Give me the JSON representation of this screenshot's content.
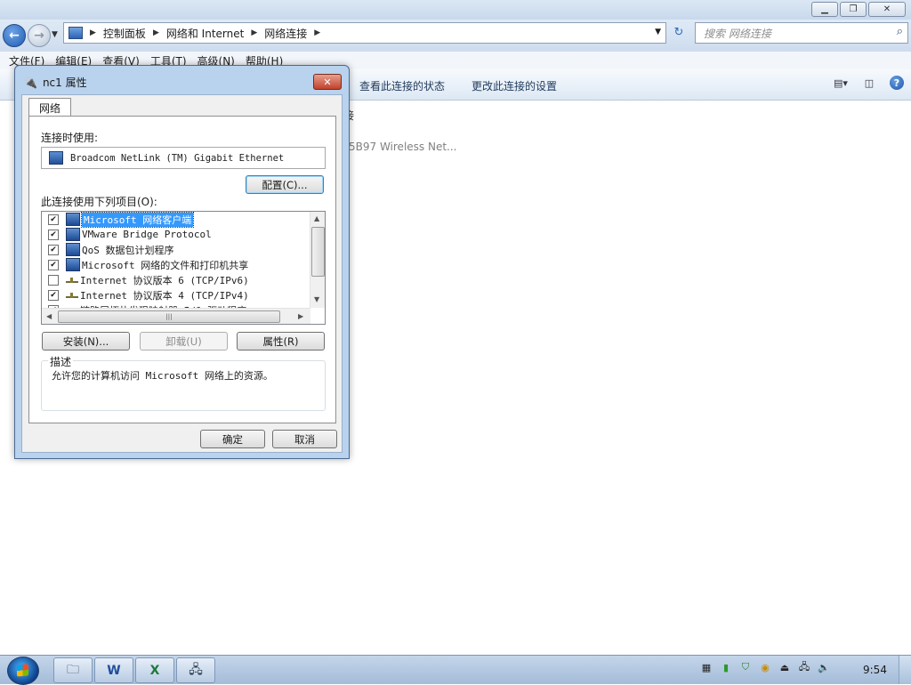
{
  "window": {
    "caption_buttons": [
      "minimize-icon",
      "restore-icon",
      "close-icon"
    ]
  },
  "navigation": {
    "breadcrumb": [
      "控制面板",
      "网络和 Internet",
      "网络连接"
    ],
    "search_placeholder": "搜索 网络连接"
  },
  "menu": [
    "文件(F)",
    "编辑(E)",
    "查看(V)",
    "工具(T)",
    "高级(N)",
    "帮助(H)"
  ],
  "command_bar": {
    "view_status": "查看此连接的状态",
    "change_settings": "更改此连接的设置"
  },
  "background": {
    "partial_label": "接",
    "partial_adapter": "5B97 Wireless Net..."
  },
  "dialog": {
    "title": "nc1 属性",
    "close_label": "✕",
    "tab": "网络",
    "connect_using_label": "连接时使用:",
    "adapter": "Broadcom NetLink (TM) Gigabit Ethernet",
    "configure_button": "配置(C)...",
    "items_label": "此连接使用下列项目(O):",
    "items": [
      {
        "label": "Microsoft 网络客户端",
        "checked": true,
        "selected": true,
        "icon": "network-client-icon"
      },
      {
        "label": "VMware Bridge Protocol",
        "checked": true,
        "selected": false,
        "icon": "network-service-icon"
      },
      {
        "label": "QoS 数据包计划程序",
        "checked": true,
        "selected": false,
        "icon": "network-service-icon"
      },
      {
        "label": "Microsoft 网络的文件和打印机共享",
        "checked": true,
        "selected": false,
        "icon": "network-service-icon"
      },
      {
        "label": "Internet 协议版本 6 (TCP/IPv6)",
        "checked": false,
        "selected": false,
        "icon": "protocol-icon"
      },
      {
        "label": "Internet 协议版本 4 (TCP/IPv4)",
        "checked": true,
        "selected": false,
        "icon": "protocol-icon"
      },
      {
        "label": "链路层拓扑发现映射器 I/O 驱动程序",
        "checked": true,
        "selected": false,
        "icon": "protocol-icon"
      }
    ],
    "install_button": "安装(N)...",
    "uninstall_button": "卸载(U)",
    "properties_button": "属性(R)",
    "description_label": "描述",
    "description_text": "允许您的计算机访问 Microsoft 网络上的资源。",
    "ok_button": "确定",
    "cancel_button": "取消"
  },
  "taskbar": {
    "pinned": [
      "explorer-icon",
      "word-icon",
      "excel-icon",
      "network-connections-icon"
    ],
    "tray_icons": [
      "film-icon",
      "battery-icon",
      "shield-icon",
      "security-icon",
      "usb-icon",
      "network-icon",
      "volume-icon"
    ],
    "clock": "9:54"
  }
}
